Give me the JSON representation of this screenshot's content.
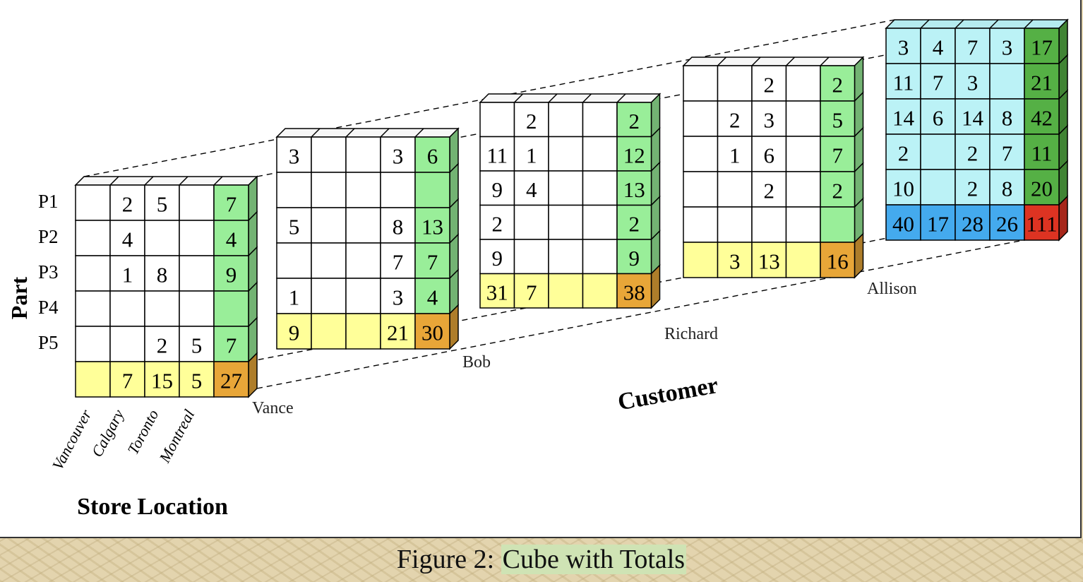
{
  "caption": {
    "prefix": "Figure 2: ",
    "highlight": "Cube with Totals"
  },
  "axes": {
    "part": "Part",
    "customer": "Customer",
    "store_location": "Store Location"
  },
  "parts": [
    "P1",
    "P2",
    "P3",
    "P4",
    "P5"
  ],
  "stores": [
    "Vancouver",
    "Calgary",
    "Toronto",
    "Montreal"
  ],
  "colors": {
    "cell": "#ffffff",
    "part_total": "#99ee99",
    "store_total": "#ffff99",
    "customer_total": "#e8a638",
    "grand_part_total": "#55b045",
    "grand_store_total": "#44aaee",
    "grand_total": "#dd3322",
    "grand_cell": "#bbf2f6"
  },
  "customers": [
    {
      "name": "Vance",
      "cells": [
        [
          "",
          "2",
          "5",
          ""
        ],
        [
          "",
          "4",
          "",
          ""
        ],
        [
          "",
          "1",
          "8",
          ""
        ],
        [
          "",
          "",
          "",
          ""
        ],
        [
          "",
          "",
          "2",
          "5"
        ]
      ],
      "part_totals": [
        "7",
        "4",
        "9",
        "",
        "7"
      ],
      "store_totals": [
        "",
        "7",
        "15",
        "5"
      ],
      "total": "27"
    },
    {
      "name": "Bob",
      "cells": [
        [
          "3",
          "",
          "",
          "3"
        ],
        [
          "",
          "",
          "",
          ""
        ],
        [
          "5",
          "",
          "",
          "8"
        ],
        [
          "",
          "",
          "",
          "7"
        ],
        [
          "1",
          "",
          "",
          "3"
        ]
      ],
      "part_totals": [
        "6",
        "",
        "13",
        "7",
        "4"
      ],
      "store_totals": [
        "9",
        "",
        "",
        "21"
      ],
      "total": "30"
    },
    {
      "name": "Richard",
      "cells": [
        [
          "",
          "2",
          "",
          ""
        ],
        [
          "11",
          "1",
          "",
          ""
        ],
        [
          "9",
          "4",
          "",
          ""
        ],
        [
          "2",
          "",
          "",
          ""
        ],
        [
          "9",
          "",
          "",
          ""
        ]
      ],
      "part_totals": [
        "2",
        "12",
        "13",
        "2",
        "9"
      ],
      "store_totals": [
        "31",
        "7",
        "",
        ""
      ],
      "total": "38"
    },
    {
      "name": "Allison",
      "cells": [
        [
          "",
          "",
          "2",
          ""
        ],
        [
          "",
          "2",
          "3",
          ""
        ],
        [
          "",
          "1",
          "6",
          ""
        ],
        [
          "",
          "",
          "2",
          ""
        ],
        [
          "",
          "",
          "",
          ""
        ]
      ],
      "part_totals": [
        "2",
        "5",
        "7",
        "2",
        ""
      ],
      "store_totals": [
        "",
        "3",
        "13",
        ""
      ],
      "total": "16"
    },
    {
      "name": "",
      "cells": [
        [
          "3",
          "4",
          "7",
          "3"
        ],
        [
          "11",
          "7",
          "3",
          ""
        ],
        [
          "14",
          "6",
          "14",
          "8"
        ],
        [
          "2",
          "",
          "2",
          "7"
        ],
        [
          "10",
          "",
          "2",
          "8"
        ]
      ],
      "part_totals": [
        "17",
        "21",
        "42",
        "11",
        "20"
      ],
      "store_totals": [
        "40",
        "17",
        "28",
        "26"
      ],
      "total": "111"
    }
  ]
}
